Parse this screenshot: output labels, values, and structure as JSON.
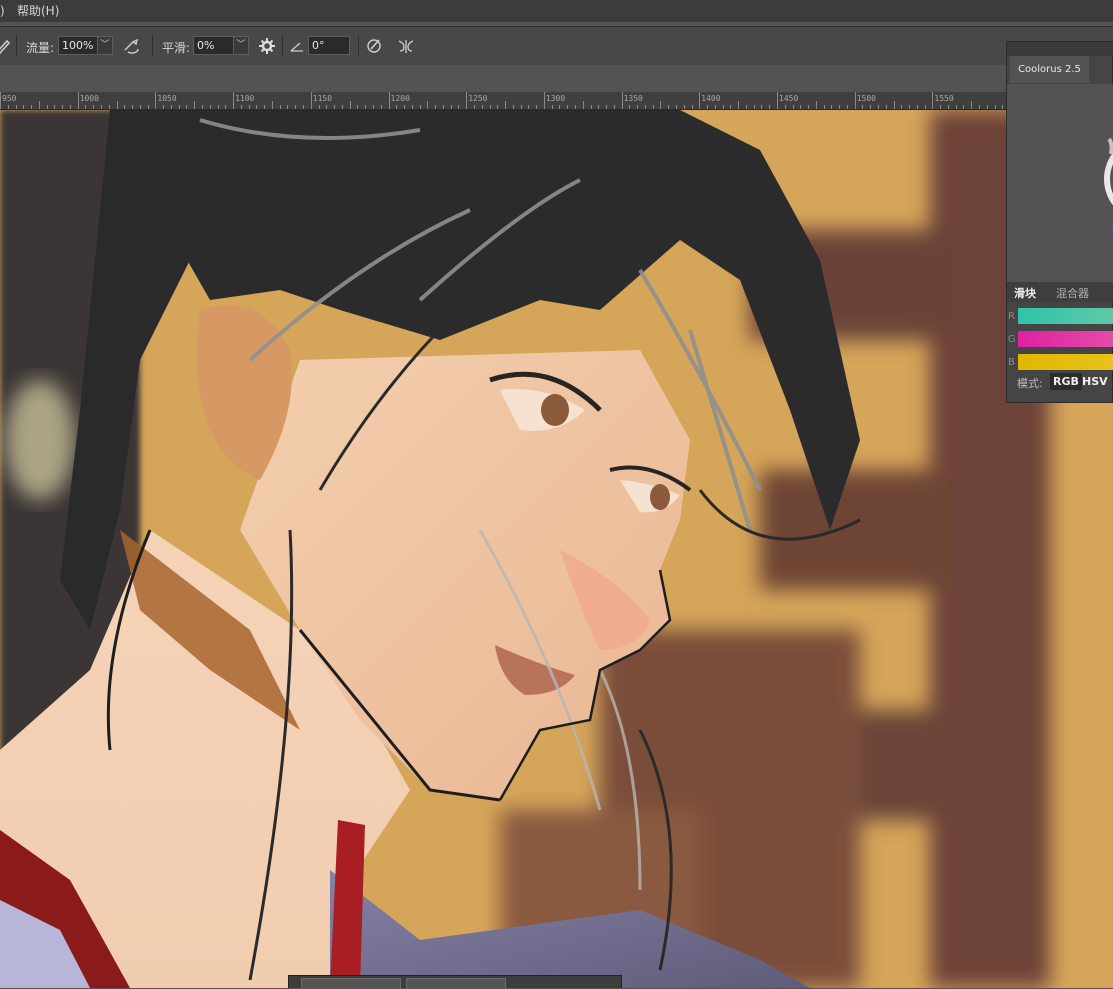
{
  "menu": {
    "left_fragment": ")",
    "help": "帮助(H)"
  },
  "options_bar": {
    "flow_label": "流量:",
    "flow_value": "100%",
    "smoothing_label": "平滑:",
    "smoothing_value": "0%",
    "angle_value": "0°",
    "icons": [
      "brush-icon",
      "airbrush-icon",
      "gear-icon",
      "angle-icon",
      "pressure-icon",
      "symmetry-icon"
    ]
  },
  "ruler": {
    "labels": [
      "950",
      "1000",
      "1050",
      "1100",
      "1150",
      "1200",
      "1250",
      "1300",
      "1350",
      "1400",
      "1450",
      "1500",
      "1550"
    ]
  },
  "canvas": {
    "content": "digital painting"
  },
  "coolorus": {
    "tab_label": "Coolorus 2.5",
    "subtab_sliders": "滑块",
    "subtab_mixer": "混合器",
    "rows": [
      "R",
      "G",
      "B"
    ],
    "mode_label": "模式:",
    "mode_rgb": "RGB",
    "mode_hsv": "HSV",
    "colors": {
      "r": "#2ec3a8",
      "g": "#e020a0",
      "b": "#e0b800"
    }
  }
}
